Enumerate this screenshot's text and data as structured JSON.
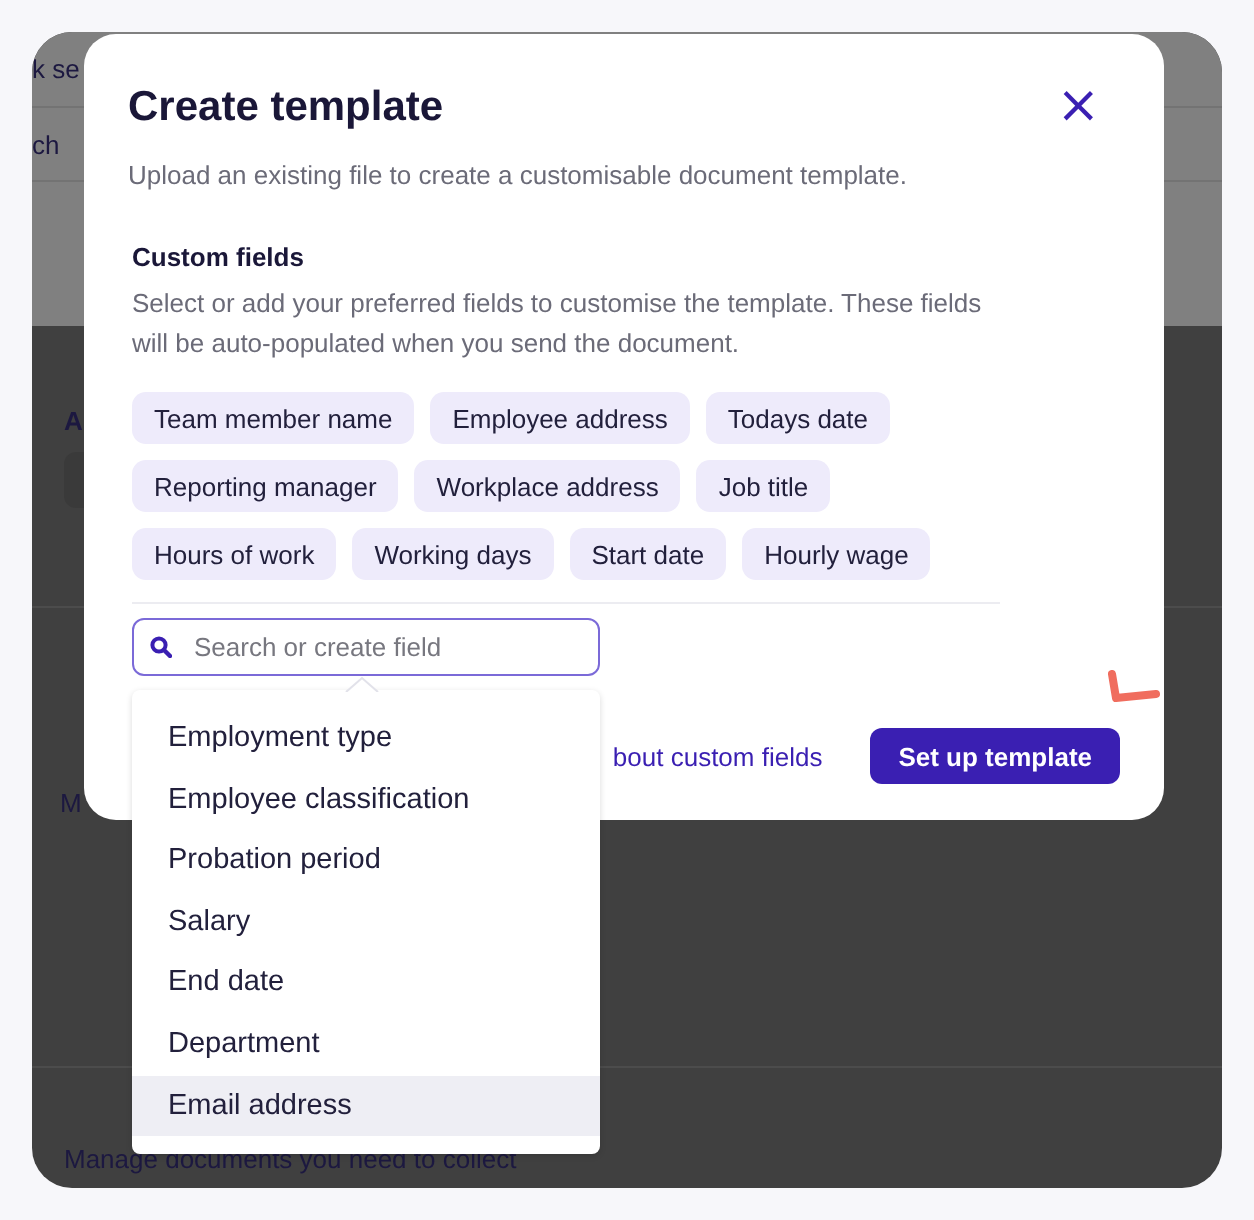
{
  "background": {
    "top_texts": [
      "k se",
      "ch"
    ],
    "section_heading": "A",
    "middle_text": "M",
    "bottom_text": "Manage documents you need to collect"
  },
  "modal": {
    "title": "Create template",
    "close": "×",
    "subtitle": "Upload an existing file to create a customisable document template.",
    "section_title": "Custom fields",
    "section_description": "Select or add your preferred fields to customise the template. These fields will be auto-populated when you send the document.",
    "chips": [
      "Team member name",
      "Employee address",
      "Todays date",
      "Reporting manager",
      "Workplace address",
      "Job title",
      "Hours of work",
      "Working days",
      "Start date",
      "Hourly wage"
    ],
    "search": {
      "placeholder": "Search or create field"
    },
    "link": "bout custom fields",
    "button": "Set up template"
  },
  "dropdown": {
    "items": [
      {
        "label": "Employment type",
        "selected": false
      },
      {
        "label": "Employee classification",
        "selected": false
      },
      {
        "label": "Probation period",
        "selected": false
      },
      {
        "label": "Salary",
        "selected": false
      },
      {
        "label": "End date",
        "selected": false
      },
      {
        "label": "Department",
        "selected": false
      },
      {
        "label": "Email address",
        "selected": true
      }
    ]
  }
}
